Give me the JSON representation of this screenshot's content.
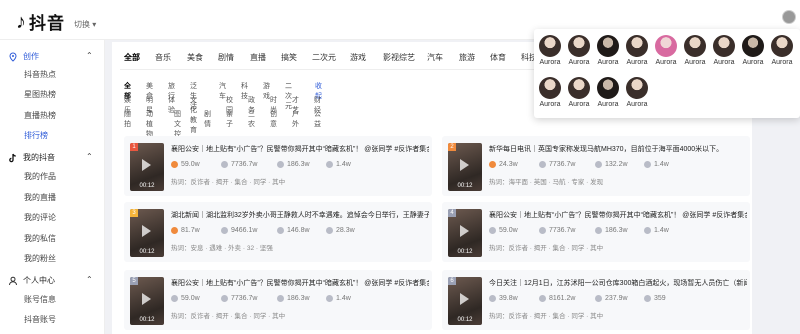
{
  "app": {
    "logo_mark": "♪",
    "name": "抖音",
    "dropdown": "切换 ▾"
  },
  "sidebar": {
    "sections": [
      {
        "title": "创作",
        "chevron": "⌃",
        "icon": "location-pin-icon",
        "title_color": "#2e5bd8",
        "items": [
          "抖音热点",
          "星图热榜",
          "直播热榜",
          "排行榜"
        ],
        "active_index": 3
      },
      {
        "title": "我的抖音",
        "chevron": "⌃",
        "icon": "douyin-icon",
        "items": [
          "我的作品",
          "我的直播",
          "我的评论",
          "我的私信",
          "我的粉丝"
        ]
      },
      {
        "title": "个人中心",
        "chevron": "⌃",
        "icon": "user-icon",
        "items": [
          "账号信息",
          "抖音账号"
        ]
      }
    ]
  },
  "tabs": [
    "全部",
    "音乐",
    "美食",
    "剧情",
    "直播",
    "搞笑",
    "二次元",
    "游戏",
    "影视综艺",
    "汽车",
    "旅游",
    "体育",
    "科技"
  ],
  "subtags": [
    [
      "全部",
      "美食",
      "旅行",
      "泛生活",
      "汽车",
      "科技",
      "游戏",
      "二次元",
      "收起"
    ],
    [
      "娱乐",
      "明星",
      "体验",
      "文化教育",
      "校园",
      "政务",
      "时尚",
      "才艺",
      "财经"
    ],
    [
      "随拍",
      "动植物",
      "图文控",
      "剧情",
      "亲子",
      "三农",
      "创意",
      "户外",
      "公益"
    ]
  ],
  "cards": [
    {
      "rank": "1",
      "rank_color": "#e9573f",
      "duration": "00:12",
      "title": "襄阳公安｜地上贴有“小广告”？民警带你揭开其中“暗藏玄机”！ @张同学 #反诈者集合",
      "plays": "59.0w",
      "likes": "7736.7w",
      "comments": "186.3w",
      "shares": "1.4w",
      "hot": "热词：反诈者 · 揭开 · 集合 · 同学 · 其中"
    },
    {
      "rank": "2",
      "rank_color": "#f08a3c",
      "duration": "00:12",
      "title": "新华每日电讯｜英国专家称发现马航MH370，目前位于海平面4000米以下。",
      "plays": "24.3w",
      "likes": "7736.7w",
      "comments": "132.2w",
      "shares": "1.4w",
      "hot": "热词：海平面 · 英国 · 马航 · 专家 · 发现"
    },
    {
      "rank": "3",
      "rank_color": "#f5b43a",
      "duration": "00:12",
      "title": "湖北新闻｜湖北监利32岁外卖小哥王静救人时不幸遇难。追悼会今日举行，王静妻子",
      "plays": "81.7w",
      "likes": "9466.1w",
      "comments": "146.8w",
      "shares": "28.3w",
      "hot": "热词：安息 · 遇难 · 外卖 · 32 · 坚强"
    },
    {
      "rank": "4",
      "rank_color": "#9aa0b4",
      "duration": "00:12",
      "title": "襄阳公安｜地上贴有“小广告”？民警带你揭开其中“暗藏玄机”！ @张同学 #反诈者集合",
      "plays": "59.0w",
      "likes": "7736.7w",
      "comments": "186.3w",
      "shares": "1.4w",
      "hot": "热词：反诈者 · 揭开 · 集合 · 同学 · 其中"
    },
    {
      "rank": "5",
      "rank_color": "#9aa0b4",
      "duration": "00:12",
      "title": "襄阳公安｜地上贴有“小广告”？民警带你揭开其中“暗藏玄机”！ @张同学 #反诈者集合",
      "plays": "59.0w",
      "likes": "7736.7w",
      "comments": "186.3w",
      "shares": "1.4w",
      "hot": "热词：反诈者 · 揭开 · 集合 · 同学 · 其中"
    },
    {
      "rank": "6",
      "rank_color": "#9aa0b4",
      "duration": "00:12",
      "title": "今日关注｜12月1日，江苏沭阳一公司仓库300箱白酒起火，现场暂无人员伤亡（新闻…",
      "plays": "39.8w",
      "likes": "8161.2w",
      "comments": "237.9w",
      "shares": "359",
      "hot": "热词：反诈者 · 揭开 · 集合 · 同学 · 其中"
    }
  ],
  "popup": {
    "rows": [
      [
        "Aurora",
        "Aurora",
        "Aurora",
        "Aurora",
        "Aurora",
        "Aurora",
        "Aurora",
        "Aurora",
        "Aurora"
      ],
      [
        "Aurora",
        "Aurora",
        "Aurora",
        "Aurora"
      ]
    ]
  }
}
